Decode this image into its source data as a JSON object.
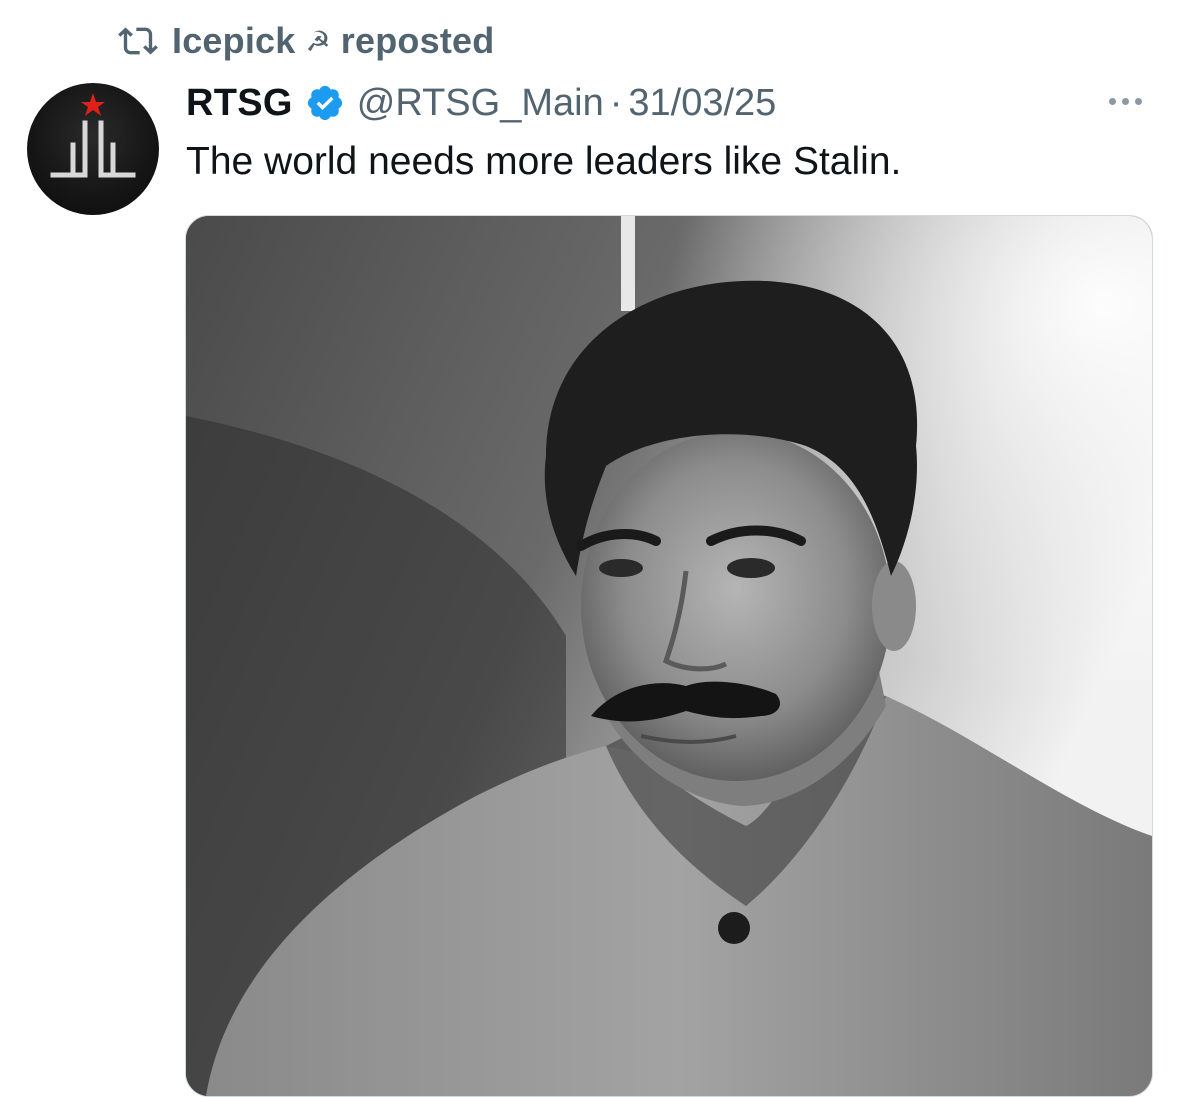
{
  "repost": {
    "icon": "repost-icon",
    "user": "Icepick",
    "emoji_icon": "hammer-and-sickle-icon",
    "emoji_glyph": "☭",
    "label": "reposted"
  },
  "tweet": {
    "avatar_icon": "rtsg-logo-avatar",
    "display_name": "RTSG",
    "verified_icon": "verified-badge-icon",
    "handle": "@RTSG_Main",
    "separator": "·",
    "date": "31/03/25",
    "more_icon": "more-options-icon",
    "text": "The world needs more leaders like Stalin.",
    "media_icon": "black-and-white-portrait-photo"
  },
  "colors": {
    "text_primary": "#0f1419",
    "text_secondary": "#536471",
    "verified_blue": "#1d9bf0",
    "border": "#cfd9de",
    "logo_star_red": "#e0201b"
  }
}
